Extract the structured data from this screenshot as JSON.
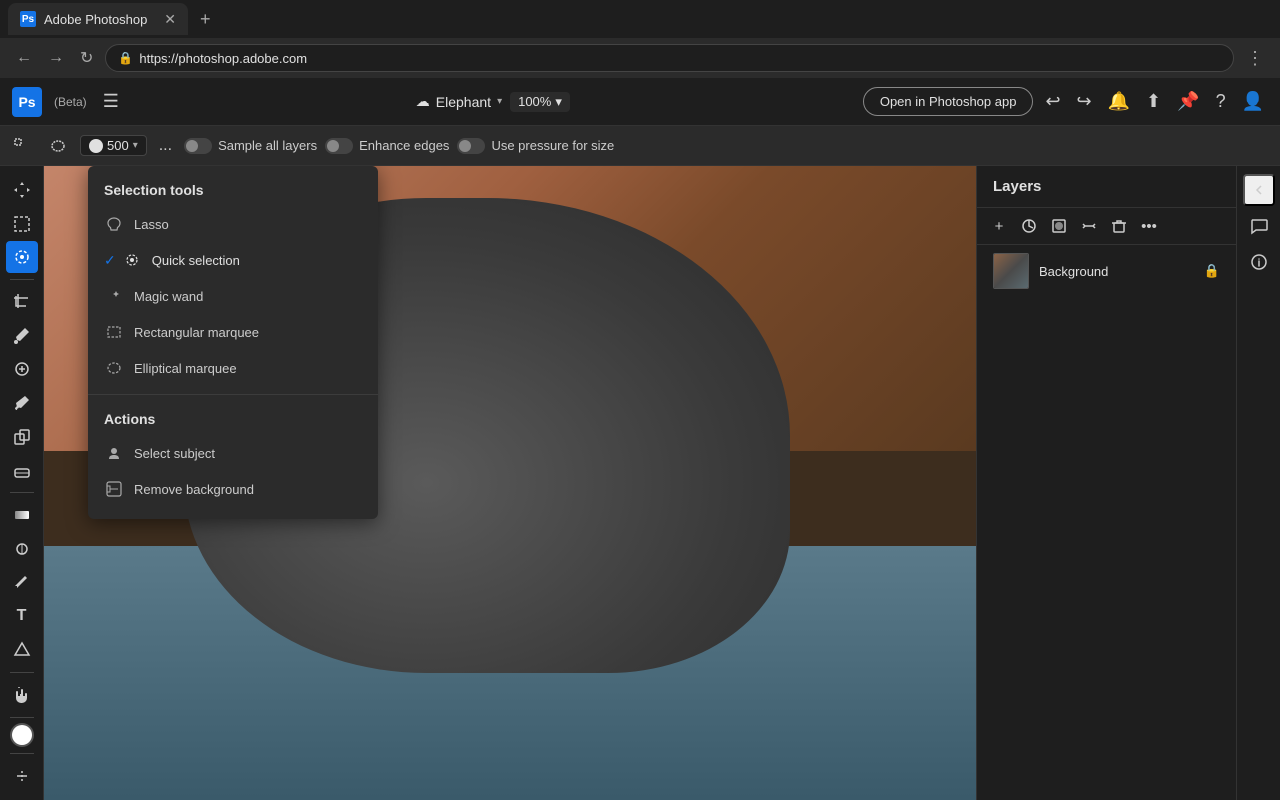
{
  "browser": {
    "tab_title": "Adobe Photoshop",
    "tab_favicon": "Ps",
    "url": "https://photoshop.adobe.com",
    "nav_back": "←",
    "nav_forward": "→",
    "nav_refresh": "↻",
    "nav_menu": "⋮"
  },
  "titlebar": {
    "logo": "Ps",
    "beta_label": "(Beta)",
    "hamburger": "☰",
    "file_name": "Elephant",
    "zoom": "100%",
    "open_in_app": "Open in Photoshop app",
    "icons": [
      "↩",
      "↪",
      "🔔",
      "⬆",
      "📌",
      "?"
    ]
  },
  "toolbar": {
    "tools": [
      "⬚",
      "⬚"
    ],
    "brush_size": "500",
    "more": "...",
    "sample_all_layers": "Sample all layers",
    "enhance_edges": "Enhance edges",
    "use_pressure": "Use pressure for size"
  },
  "left_tools": [
    {
      "name": "move",
      "icon": "✛"
    },
    {
      "name": "selection",
      "icon": "⬚"
    },
    {
      "name": "quick-selection",
      "icon": "⊕",
      "active": true
    },
    {
      "name": "crop",
      "icon": "⊞"
    },
    {
      "name": "eyedropper",
      "icon": "✏"
    },
    {
      "name": "healing",
      "icon": "⊗"
    },
    {
      "name": "brush",
      "icon": "⌂"
    },
    {
      "name": "clone",
      "icon": "⊞"
    },
    {
      "name": "eraser",
      "icon": "⬜"
    },
    {
      "name": "gradient",
      "icon": "▣"
    },
    {
      "name": "dodge",
      "icon": "⊙"
    },
    {
      "name": "pen",
      "icon": "✒"
    },
    {
      "name": "type",
      "icon": "T"
    },
    {
      "name": "shape",
      "icon": "⬟"
    },
    {
      "name": "hand",
      "icon": "✋"
    },
    {
      "name": "zoom",
      "icon": "⊕"
    }
  ],
  "dropdown": {
    "section1_title": "Selection tools",
    "items": [
      {
        "name": "lasso",
        "label": "Lasso",
        "active": false,
        "icon": "lasso"
      },
      {
        "name": "quick-selection",
        "label": "Quick selection",
        "active": true,
        "icon": "quick"
      },
      {
        "name": "magic-wand",
        "label": "Magic wand",
        "active": false,
        "icon": "wand"
      },
      {
        "name": "rectangular-marquee",
        "label": "Rectangular marquee",
        "active": false,
        "icon": "rect"
      },
      {
        "name": "elliptical-marquee",
        "label": "Elliptical marquee",
        "active": false,
        "icon": "ellip"
      }
    ],
    "section2_title": "Actions",
    "actions": [
      {
        "name": "select-subject",
        "label": "Select subject",
        "icon": "subject"
      },
      {
        "name": "remove-background",
        "label": "Remove background",
        "icon": "removebg"
      }
    ]
  },
  "layers_panel": {
    "title": "Layers",
    "actions": [
      "+",
      "◉",
      "▣",
      "⬚",
      "🗑",
      "..."
    ],
    "layers": [
      {
        "name": "Background",
        "locked": true
      }
    ]
  },
  "right_collapsed": {
    "icons": [
      "💬",
      "ℹ"
    ]
  }
}
